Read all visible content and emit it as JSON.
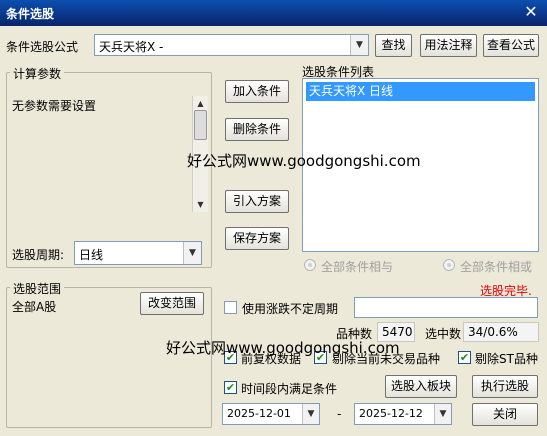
{
  "window": {
    "title": "条件选股",
    "close_glyph": "✕"
  },
  "formula": {
    "label": "条件选股公式",
    "value": "天兵天将X  -",
    "find_button": "查找",
    "usage_button": "用法注释",
    "view_button": "查看公式"
  },
  "params": {
    "group_title": "计算参数",
    "message": "无参数需要设置",
    "period_label": "选股周期:",
    "period_value": "日线"
  },
  "actions": {
    "add": "加入条件",
    "delete": "删除条件",
    "import": "引入方案",
    "save": "保存方案"
  },
  "conditions": {
    "title": "选股条件列表",
    "items": [
      "天兵天将X  日线"
    ],
    "radio_and": "全部条件相与",
    "radio_or": "全部条件相或"
  },
  "status": {
    "done_text": "选股完毕.",
    "done_color": "#e00000"
  },
  "range": {
    "group_title": "选股范围",
    "value": "全部A股",
    "change_button": "改变范围"
  },
  "options": {
    "irregular_period_label": "使用涨跌不定周期",
    "irregular_period_checked": false,
    "stock_count_label": "品种数",
    "stock_count_value": "5470",
    "selected_label": "选中数",
    "selected_value": "34/0.6%",
    "adjusted_label": "前复权数据",
    "adjusted_checked": true,
    "exclude_notrade_label": "剔除当前未交易品种",
    "exclude_notrade_checked": true,
    "exclude_st_label": "剔除ST品种",
    "exclude_st_checked": true,
    "time_range_label": "时间段内满足条件",
    "time_range_checked": true,
    "check_glyph": "✔"
  },
  "bottom": {
    "to_block_button": "选股入板块",
    "execute_button": "执行选股",
    "close_button": "关闭",
    "date_from": "2025-12-01",
    "date_sep": "-",
    "date_to": "2025-12-12"
  },
  "watermarks": [
    "好公式网www.goodgongshi.com",
    "好公式网www.goodgongshi.com"
  ],
  "icons": {
    "combo_arrow": "chevron-down-icon",
    "scroll_up": "arrow-up-icon",
    "scroll_down": "arrow-down-icon"
  }
}
